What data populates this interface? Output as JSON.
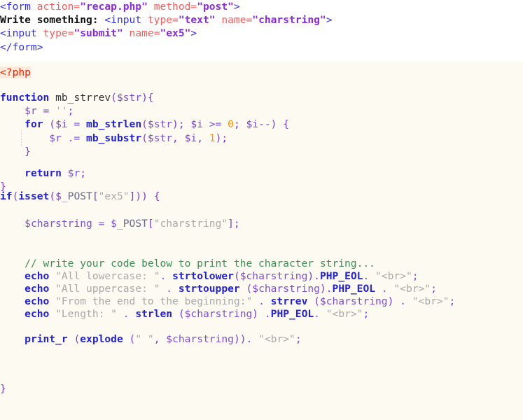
{
  "editor": {
    "kind": "code-editor-source-view",
    "language": "php",
    "background_html": "#ffffff",
    "background_php": "#fdfaf1",
    "php_open_highlight": "#fdeadb"
  },
  "palette": {
    "tag": "#3333ee",
    "attribute": "#ff5a5a",
    "attribute_value": "#8a2be2",
    "keyword": "#2222dd",
    "function": "#2222dd",
    "variable": "#7b4fd8",
    "string": "#a8a8a8",
    "number": "#ff9500",
    "comment": "#3c8f56",
    "punctuation": "#7a3fd0",
    "php_open_tag": "#ee2200"
  },
  "lines": {
    "l1": {
      "t1": "<form ",
      "t2": "action=",
      "t3": "\"recap.php\"",
      "t4": " ",
      "t5": "method=",
      "t6": "\"post\"",
      "t7": ">"
    },
    "l2": {
      "t1": "Write something: ",
      "t2": "<input ",
      "t3": "type=",
      "t4": "\"text\"",
      "t5": " ",
      "t6": "name=",
      "t7": "\"charstring\"",
      "t8": ">"
    },
    "l3": {
      "t1": "<input ",
      "t2": "type=",
      "t3": "\"submit\"",
      "t4": " ",
      "t5": "name=",
      "t6": "\"ex5\"",
      "t7": ">"
    },
    "l4": {
      "t1": "</form>"
    },
    "l6": {
      "t1": "<?php"
    },
    "l8": {
      "t1": "function",
      "t2": " mb_strrev",
      "t3": "($",
      "t4": "str",
      "t5": ")",
      "t6": "{"
    },
    "l9": {
      "t1": "    $",
      "t2": "r",
      "t3": " = ",
      "t4": "''",
      "t5": ";"
    },
    "l10": {
      "t1": "    ",
      "t2": "for",
      "t3": " ($",
      "t4": "i",
      "t5": " = ",
      "t6": "mb_strlen",
      "t7": "($",
      "t8": "str",
      "t9": "); $",
      "t10": "i",
      "t11": " >= ",
      "t12": "0",
      "t13": "; $",
      "t14": "i",
      "t15": "--) {"
    },
    "l11": {
      "t1": "        $",
      "t2": "r",
      "t3": " .= ",
      "t4": "mb_substr",
      "t5": "($",
      "t6": "str",
      "t7": ", $",
      "t8": "i",
      "t9": ", ",
      "t10": "1",
      "t11": ");"
    },
    "l12": {
      "t1": "    }"
    },
    "l14": {
      "t1": "    ",
      "t2": "return",
      "t3": " $",
      "t4": "r",
      "t5": ";"
    },
    "l15": {
      "t1": "}"
    },
    "l16": {
      "t1": "if",
      "t2": "(",
      "t3": "isset",
      "t4": "($",
      "t5": "_POST",
      "t6": "[",
      "t7": "\"ex5\"",
      "t8": "])) {"
    },
    "l18": {
      "t1": "    $",
      "t2": "charstring",
      "t3": " = $",
      "t4": "_POST",
      "t5": "[",
      "t6": "\"charstring\"",
      "t7": "];"
    },
    "l21": {
      "t1": "    // write your code below to print the character string..."
    },
    "l22": {
      "t1": "    ",
      "t2": "echo",
      "t3": " ",
      "t4": "\"All lowercase: \"",
      "t5": ". ",
      "t6": "strtolower",
      "t7": "($",
      "t8": "charstring",
      "t9": ").",
      "t10": "PHP_EOL",
      "t11": ". ",
      "t12": "\"<br>\"",
      "t13": ";"
    },
    "l23": {
      "t1": "    ",
      "t2": "echo",
      "t3": " ",
      "t4": "\"All uppercase: \"",
      "t5": " . ",
      "t6": "strtoupper",
      "t7": " ($",
      "t8": "charstring",
      "t9": ").",
      "t10": "PHP_EOL",
      "t11": " . ",
      "t12": "\"<br>\"",
      "t13": ";"
    },
    "l24": {
      "t1": "    ",
      "t2": "echo",
      "t3": " ",
      "t4": "\"From the end to the beginning:\"",
      "t5": " . ",
      "t6": "strrev",
      "t7": " ($",
      "t8": "charstring",
      "t9": ") . ",
      "t10": "\"<br>\"",
      "t11": ";"
    },
    "l25": {
      "t1": "    ",
      "t2": "echo",
      "t3": " ",
      "t4": "\"Length: \"",
      "t5": " . ",
      "t6": "strlen",
      "t7": " ($",
      "t8": "charstring",
      "t9": ") .",
      "t10": "PHP_EOL",
      "t11": ". ",
      "t12": "\"<br>\"",
      "t13": ";"
    },
    "l27": {
      "t1": "    ",
      "t2": "print_r",
      "t3": " (",
      "t4": "explode",
      "t5": " (",
      "t6": "\" \"",
      "t7": ", $",
      "t8": "charstring",
      "t9": ")). ",
      "t10": "\"<br>\"",
      "t11": ";"
    },
    "l32": {
      "t1": "}"
    }
  }
}
